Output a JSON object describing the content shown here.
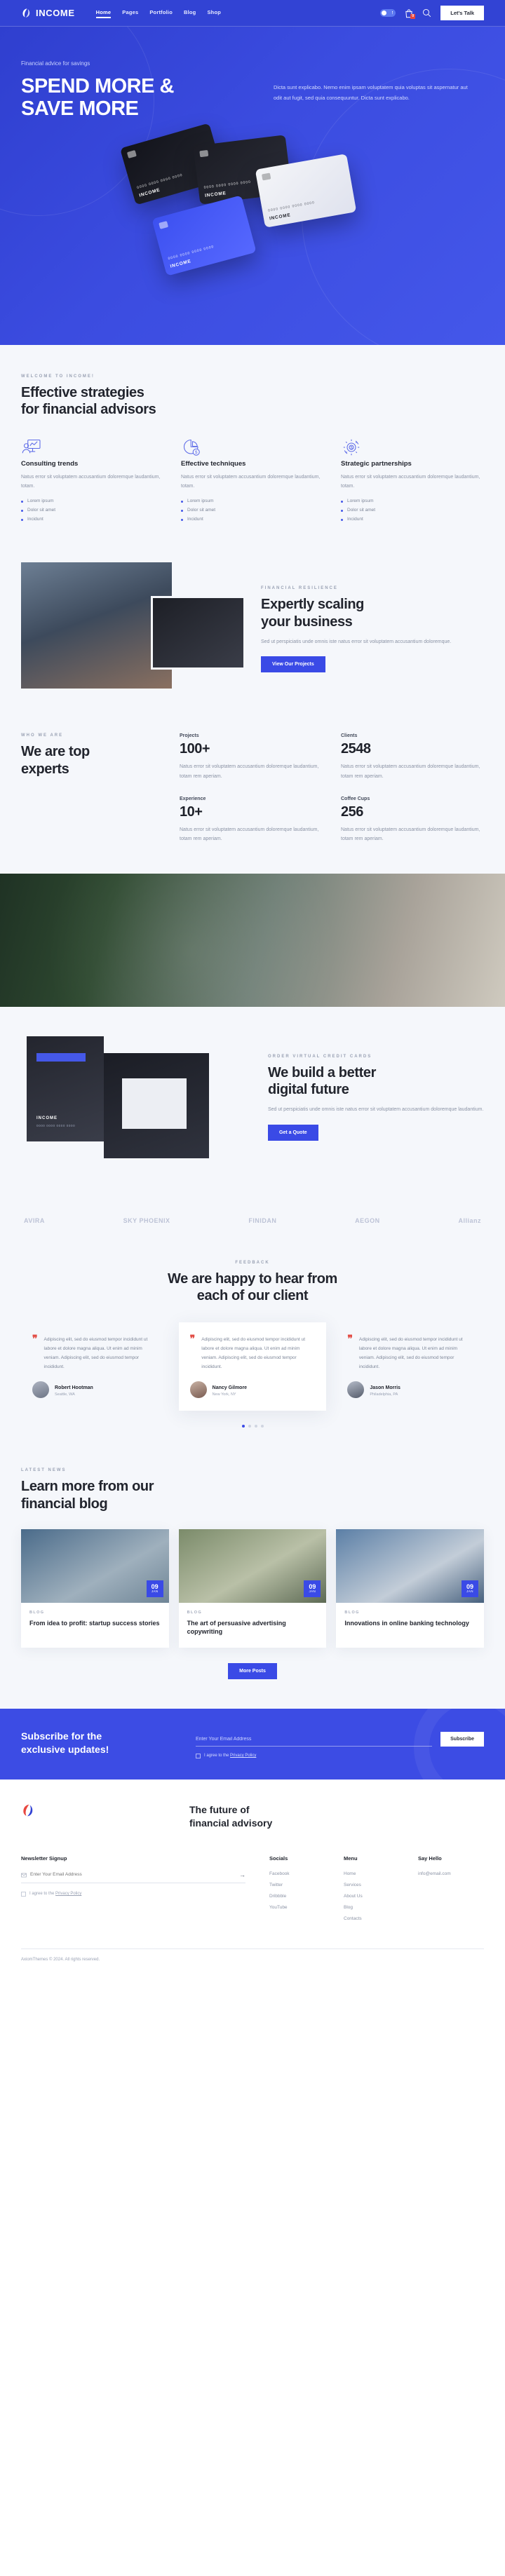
{
  "nav": {
    "brand": "INCOME",
    "brand_icon": "income-logo-icon",
    "links": [
      {
        "label": "Home",
        "active": true
      },
      {
        "label": "Pages",
        "active": false
      },
      {
        "label": "Portfolio",
        "active": false
      },
      {
        "label": "Blog",
        "active": false
      },
      {
        "label": "Shop",
        "active": false
      }
    ],
    "toggle_icon": "dark-mode-toggle-icon",
    "cart_icon": "shopping-bag-icon",
    "cart_count": "0",
    "search_icon": "search-icon",
    "cta": "Let's Talk"
  },
  "hero": {
    "label": "Financial advice for savings",
    "title_line1": "SPEND MORE &",
    "title_line2": "SAVE MORE",
    "desc": "Dicta sunt explicabo. Nemo enim ipsam voluptatem quia voluptas sit aspernatur aut odit aut fugit, sed quia consequuntur. Dicta sunt explicabo.",
    "cards": [
      {
        "name": "INCOME",
        "number": "0000 0000 0000 0000"
      },
      {
        "name": "INCOME",
        "number": "0000 0000 0000 0000"
      },
      {
        "name": "INCOME",
        "number": "0000 0000 0000 0000"
      },
      {
        "name": "INCOME",
        "number": "0000 0000 0000 0000"
      }
    ]
  },
  "welcome": {
    "eyebrow": "WELCOME TO INCOME!",
    "title_line1": "Effective strategies",
    "title_line2": "for financial advisors",
    "features": [
      {
        "icon": "analytics-chart-icon",
        "title": "Consulting trends",
        "desc": "Natus error sit voluptatem accusantium doloremque laudantium, totam.",
        "items": [
          "Lorem ipsum",
          "Dolor sit amet",
          "Incidunt"
        ]
      },
      {
        "icon": "pie-chart-dollar-icon",
        "title": "Effective techniques",
        "desc": "Natus error sit voluptatem accusantium doloremque laudantium, totam.",
        "items": [
          "Lorem ipsum",
          "Dolor sit amet",
          "Incidunt"
        ]
      },
      {
        "icon": "gear-dollar-cycle-icon",
        "title": "Strategic partnerships",
        "desc": "Natus error sit voluptatem accusantium doloremque laudantium, totam.",
        "items": [
          "Lorem ipsum",
          "Dolor sit amet",
          "Incidunt"
        ]
      }
    ]
  },
  "scaling": {
    "eyebrow": "FINANCIAL RESILIENCE",
    "title_line1": "Expertly scaling",
    "title_line2": "your business",
    "desc": "Sed ut perspiciatis unde omnis iste natus error sit voluptatem accusantium doloremque.",
    "button": "View Our Projects"
  },
  "stats": {
    "eyebrow": "WHO WE ARE",
    "title_line1": "We are top",
    "title_line2": "experts",
    "items": [
      {
        "label": "Projects",
        "value": "100+",
        "desc": "Natus error sit voluptatem accusantium doloremque laudantium, totam rem aperiam."
      },
      {
        "label": "Clients",
        "value": "2548",
        "desc": "Natus error sit voluptatem accusantium doloremque laudantium, totam rem aperiam."
      },
      {
        "label": "Experience",
        "value": "10+",
        "desc": "Natus error sit voluptatem accusantium doloremque laudantium, totam rem aperiam."
      },
      {
        "label": "Coffee Cups",
        "value": "256",
        "desc": "Natus error sit voluptatem accusantium doloremque laudantium, totam rem aperiam."
      }
    ]
  },
  "virtual": {
    "eyebrow": "ORDER VIRTUAL CREDIT CARDS",
    "title_line1": "We build a better",
    "title_line2": "digital future",
    "desc": "Sed ut perspiciatis unde omnis iste natus error sit voluptatem accusantium doloremque laudantium.",
    "button": "Get a Quote",
    "card_label": "INCOME",
    "card_sub": "0000 0000 0000 0000"
  },
  "logos": [
    {
      "name": "AVIRA"
    },
    {
      "name": "SKY PHOENIX"
    },
    {
      "name": "FINIDAN"
    },
    {
      "name": "AEGON"
    },
    {
      "name": "Allianz"
    }
  ],
  "testimonials": {
    "eyebrow": "FEEDBACK",
    "title_line1": "We are happy to hear from",
    "title_line2": "each of our client",
    "quote_icon": "quote-mark-icon",
    "items": [
      {
        "text": "Adipiscing elit, sed do eiusmod tempor incididunt ut labore et dolore magna aliqua. Ut enim ad minim veniam. Adipiscing elit, sed do eiusmod tempor incididunt.",
        "name": "Robert Hootman",
        "location": "Seattle, WA"
      },
      {
        "text": "Adipiscing elit, sed do eiusmod tempor incididunt ut labore et dolore magna aliqua. Ut enim ad minim veniam. Adipiscing elit, sed do eiusmod tempor incididunt.",
        "name": "Nancy Gilmore",
        "location": "New York, NY"
      },
      {
        "text": "Adipiscing elit, sed do eiusmod tempor incididunt ut labore et dolore magna aliqua. Ut enim ad minim veniam. Adipiscing elit, sed do eiusmod tempor incididunt.",
        "name": "Jason Morris",
        "location": "Philadelphia, PA"
      }
    ],
    "dots": 4,
    "active_dot": 0
  },
  "blog": {
    "eyebrow": "LATEST NEWS",
    "title_line1": "Learn more from our",
    "title_line2": "financial blog",
    "button": "More Posts",
    "posts": [
      {
        "day": "09",
        "month": "JAN",
        "category": "BLOG",
        "title": "From idea to profit: startup success stories"
      },
      {
        "day": "09",
        "month": "JAN",
        "category": "BLOG",
        "title": "The art of persuasive advertising copywriting"
      },
      {
        "day": "09",
        "month": "JAN",
        "category": "BLOG",
        "title": "Innovations in online banking technology"
      }
    ]
  },
  "subscribe": {
    "title_line1": "Subscribe for the",
    "title_line2": "exclusive updates!",
    "input_placeholder": "Enter Your Email Address",
    "button": "Subscribe",
    "agree_prefix": "I agree to the ",
    "agree_link": "Privacy Policy"
  },
  "footer": {
    "logo_icon": "income-logo-icon",
    "tagline_line1": "The future of",
    "tagline_line2": "financial advisory",
    "newsletter_heading": "Newsletter Signup",
    "newsletter_placeholder": "Enter Your Email Address",
    "mail_icon": "mail-icon",
    "submit_icon": "arrow-right-icon",
    "agree_prefix": "I agree to the ",
    "agree_link": "Privacy Policy",
    "columns": [
      {
        "heading": "Socials",
        "links": [
          "Facebook",
          "Twitter",
          "Dribbble",
          "YouTube"
        ]
      },
      {
        "heading": "Menu",
        "links": [
          "Home",
          "Services",
          "About Us",
          "Blog",
          "Contacts"
        ]
      },
      {
        "heading": "Say Hello",
        "links": [
          "info@email.com"
        ]
      }
    ],
    "copyright": "AxiomThemes © 2024. All rights reserved."
  },
  "colors": {
    "brand_blue": "#3243d4",
    "accent_blue": "#3a4ae6",
    "light_bg": "#f5f7fb",
    "quote_red": "#e24b43"
  }
}
